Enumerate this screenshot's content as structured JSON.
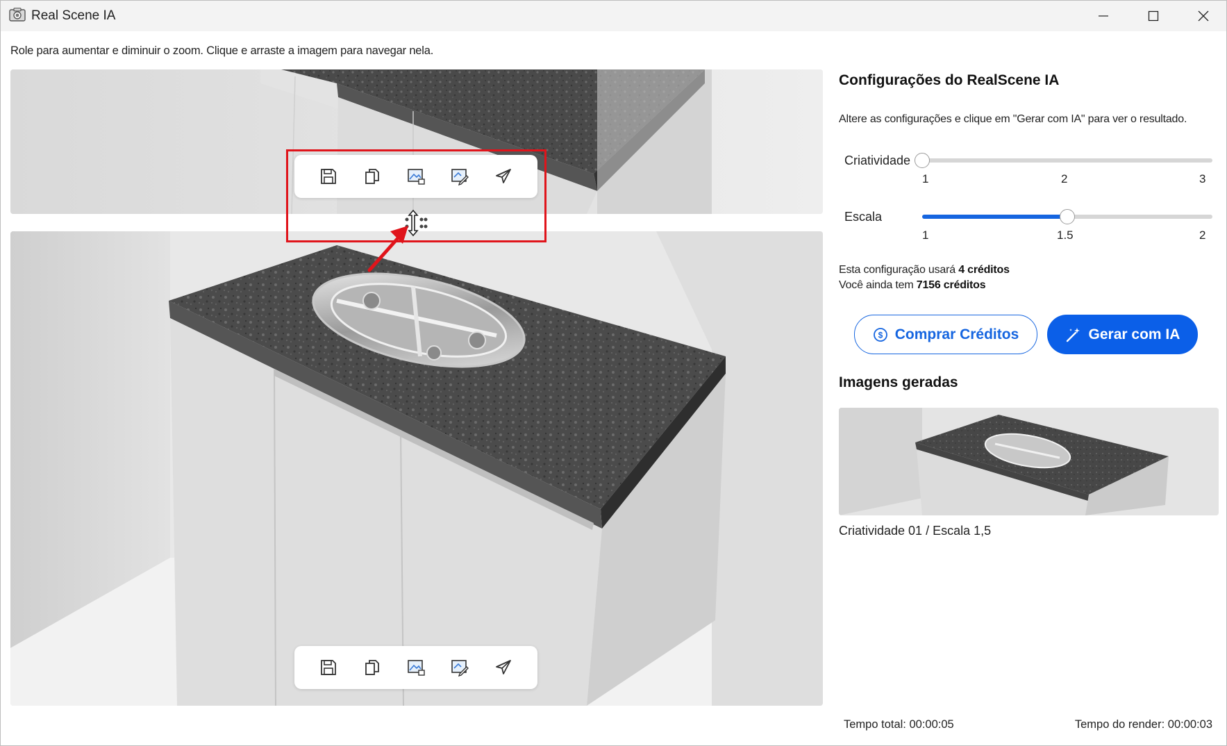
{
  "window": {
    "title": "Real Scene IA",
    "controls": {
      "minimize_icon": "minimize-icon",
      "maximize_icon": "maximize-icon",
      "close_icon": "close-icon"
    }
  },
  "viewer": {
    "hint": "Role para aumentar e diminuir o zoom. Clique e arraste a imagem para navegar nela.",
    "toolbar_icons": [
      "save-icon",
      "copy-icon",
      "image-export-icon",
      "image-edit-icon",
      "send-icon"
    ]
  },
  "panel": {
    "title": "Configurações do RealScene IA",
    "description": "Altere as configurações e clique em \"Gerar com IA\" para ver o resultado.",
    "sliders": {
      "criatividade": {
        "label": "Criatividade",
        "ticks": [
          "1",
          "2",
          "3"
        ],
        "value": 1,
        "min": 1,
        "max": 3
      },
      "escala": {
        "label": "Escala",
        "ticks": [
          "1",
          "1.5",
          "2"
        ],
        "value": 1.5,
        "min": 1,
        "max": 2
      }
    },
    "credits": {
      "line1_prefix": "Esta configuração usará",
      "line1_value": "4 créditos",
      "line2_prefix": "Você ainda tem",
      "line2_value": "7156 créditos"
    },
    "buttons": {
      "buy": "Comprar Créditos",
      "generate": "Gerar com IA"
    },
    "accent_color": "#0b5fe8",
    "generated": {
      "title": "Imagens geradas",
      "items": [
        {
          "caption": "Criatividade 01 / Escala 1,5"
        }
      ]
    }
  },
  "footer": {
    "total_time": "Tempo total: 00:00:05",
    "render_time": "Tempo do render: 00:00:03"
  },
  "annotation": {
    "highlight_color": "#e0141b"
  }
}
